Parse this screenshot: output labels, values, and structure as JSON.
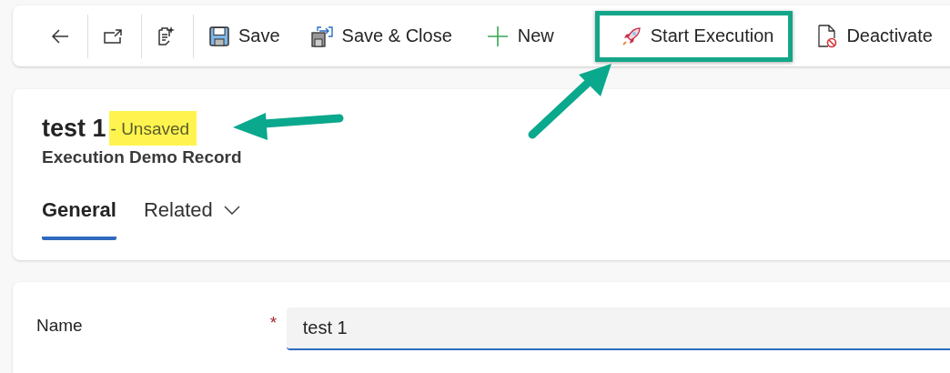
{
  "toolbar": {
    "items": [
      {
        "kind": "icon"
      },
      {
        "kind": "icon"
      },
      {
        "kind": "icon"
      },
      {
        "kind": "button",
        "label": "Save",
        "highlighted": false
      },
      {
        "kind": "button",
        "label": "Save & Close",
        "highlighted": false
      },
      {
        "kind": "button",
        "label": "New",
        "highlighted": false
      },
      {
        "kind": "button",
        "label": "Start Execution",
        "highlighted": true
      },
      {
        "kind": "button",
        "label": "Deactivate",
        "highlighted": false
      }
    ]
  },
  "header": {
    "title": "test 1",
    "status": "- Unsaved",
    "status_highlighted": true,
    "entity": "Execution Demo Record",
    "tabs": [
      {
        "label": "General",
        "selected": true,
        "dropdown": false
      },
      {
        "label": "Related",
        "selected": false,
        "dropdown": true
      }
    ]
  },
  "form": {
    "fields": [
      {
        "label": "Name",
        "required": true,
        "required_mark": "*",
        "value": "test 1"
      }
    ]
  }
}
